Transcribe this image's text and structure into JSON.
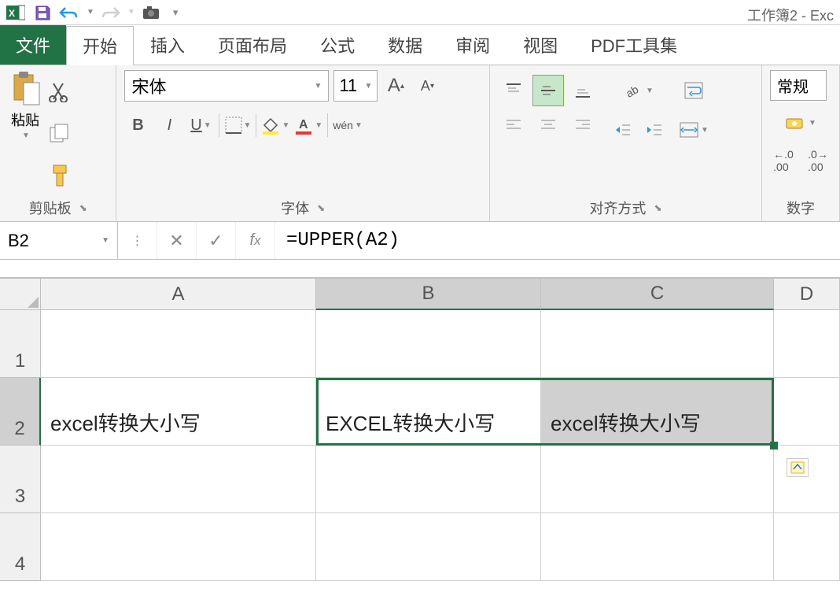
{
  "title": "工作簿2 - Exc",
  "tabs": {
    "file": "文件",
    "home": "开始",
    "insert": "插入",
    "layout": "页面布局",
    "formula": "公式",
    "data": "数据",
    "review": "审阅",
    "view": "视图",
    "pdf": "PDF工具集"
  },
  "ribbon": {
    "clipboard": {
      "label": "剪贴板",
      "paste": "粘贴"
    },
    "font": {
      "label": "字体",
      "name": "宋体",
      "size": "11",
      "bold": "B",
      "italic": "I",
      "underline": "U",
      "pinyin": "wén"
    },
    "align": {
      "label": "对齐方式"
    },
    "number": {
      "label": "数字",
      "format": "常规"
    }
  },
  "namebox": "B2",
  "formula": "=UPPER(A2)",
  "columns": [
    "A",
    "B",
    "C",
    "D"
  ],
  "rows": [
    "1",
    "2",
    "3",
    "4"
  ],
  "cells": {
    "A2": "excel转换大小写",
    "B2": "EXCEL转换大小写",
    "C2": "excel转换大小写"
  }
}
